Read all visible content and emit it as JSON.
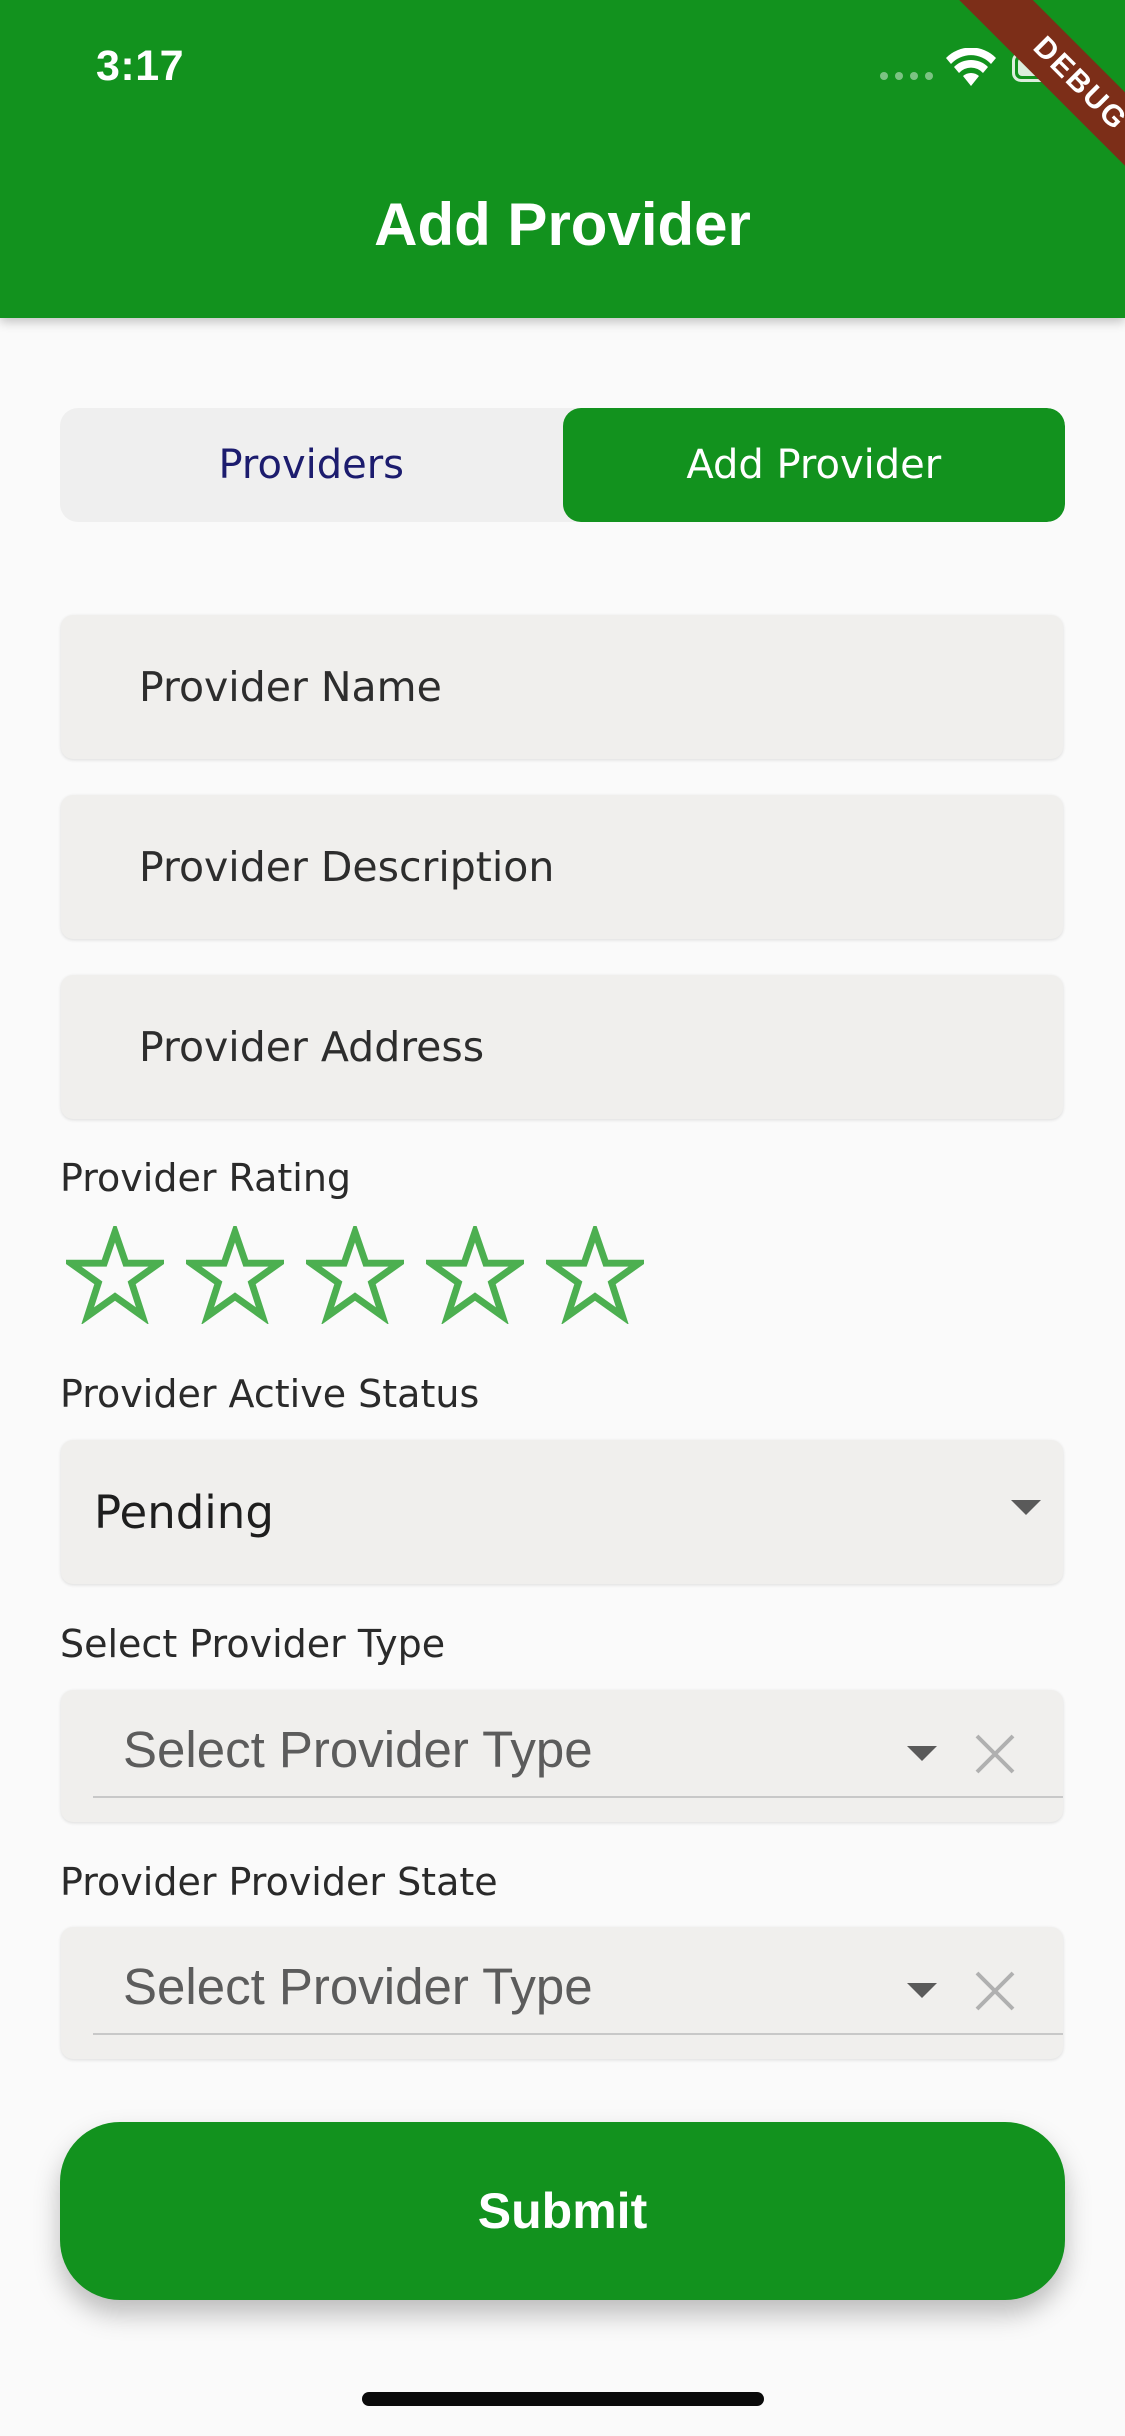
{
  "status_bar": {
    "time": "3:17",
    "debug_label": "DEBUG"
  },
  "appbar": {
    "title": "Add Provider"
  },
  "segment": {
    "tabs": [
      {
        "label": "Providers"
      },
      {
        "label": "Add Provider"
      }
    ],
    "active_index": 1
  },
  "form": {
    "name_placeholder": "Provider Name",
    "description_placeholder": "Provider Description",
    "address_placeholder": "Provider Address",
    "rating_label": "Provider Rating",
    "rating_value": 0,
    "rating_max": 5,
    "active_status_label": "Provider Active Status",
    "active_status_value": "Pending",
    "type_label": "Select Provider Type",
    "type_placeholder": "Select Provider Type",
    "state_label": "Provider Provider State",
    "state_placeholder": "Select Provider Type"
  },
  "submit": {
    "label": "Submit"
  },
  "colors": {
    "primary": "#12921e",
    "star": "#4caf50",
    "tab_text": "#1c1c6e",
    "field_bg": "#f0efed"
  },
  "icons": [
    "wifi-icon",
    "battery-icon",
    "star-outline-icon",
    "dropdown-caret-icon",
    "clear-icon"
  ]
}
